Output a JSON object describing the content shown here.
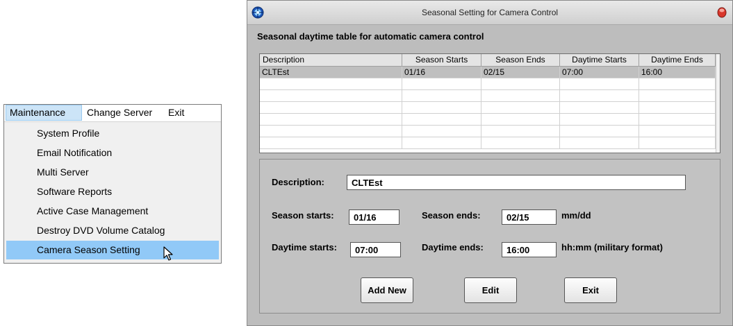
{
  "menu": {
    "bar": [
      "Maintenance",
      "Change Server",
      "Exit"
    ],
    "items": [
      "System Profile",
      "Email Notification",
      "Multi Server",
      "Software Reports",
      "Active Case Management",
      "Destroy DVD Volume Catalog",
      "Camera Season Setting"
    ],
    "selected_item": "Camera Season Setting"
  },
  "window": {
    "title": "Seasonal Setting for Camera Control",
    "heading": "Seasonal daytime table for automatic camera control"
  },
  "table": {
    "columns": [
      "Description",
      "Season Starts",
      "Season Ends",
      "Daytime Starts",
      "Daytime Ends"
    ],
    "rows": [
      [
        "CLTEst",
        "01/16",
        "02/15",
        "07:00",
        "16:00"
      ]
    ]
  },
  "form": {
    "description_label": "Description:",
    "description_value": "CLTEst",
    "season_starts_label": "Season starts:",
    "season_starts_value": "01/16",
    "season_ends_label": "Season ends:",
    "season_ends_value": "02/15",
    "date_hint": "mm/dd",
    "daytime_starts_label": "Daytime starts:",
    "daytime_starts_value": "07:00",
    "daytime_ends_label": "Daytime ends:",
    "daytime_ends_value": "16:00",
    "time_hint": "hh:mm (military format)"
  },
  "buttons": {
    "add_new": "Add New",
    "edit": "Edit",
    "exit": "Exit"
  },
  "icons": {
    "app": "target-icon",
    "close": "close-icon",
    "cursor": "mouse-pointer-icon"
  },
  "colors": {
    "menu_highlight": "#91c9f7",
    "menubar_active": "#cce4f7",
    "window_bg": "#bdbdbd",
    "row_selected": "#bfbfbf"
  }
}
